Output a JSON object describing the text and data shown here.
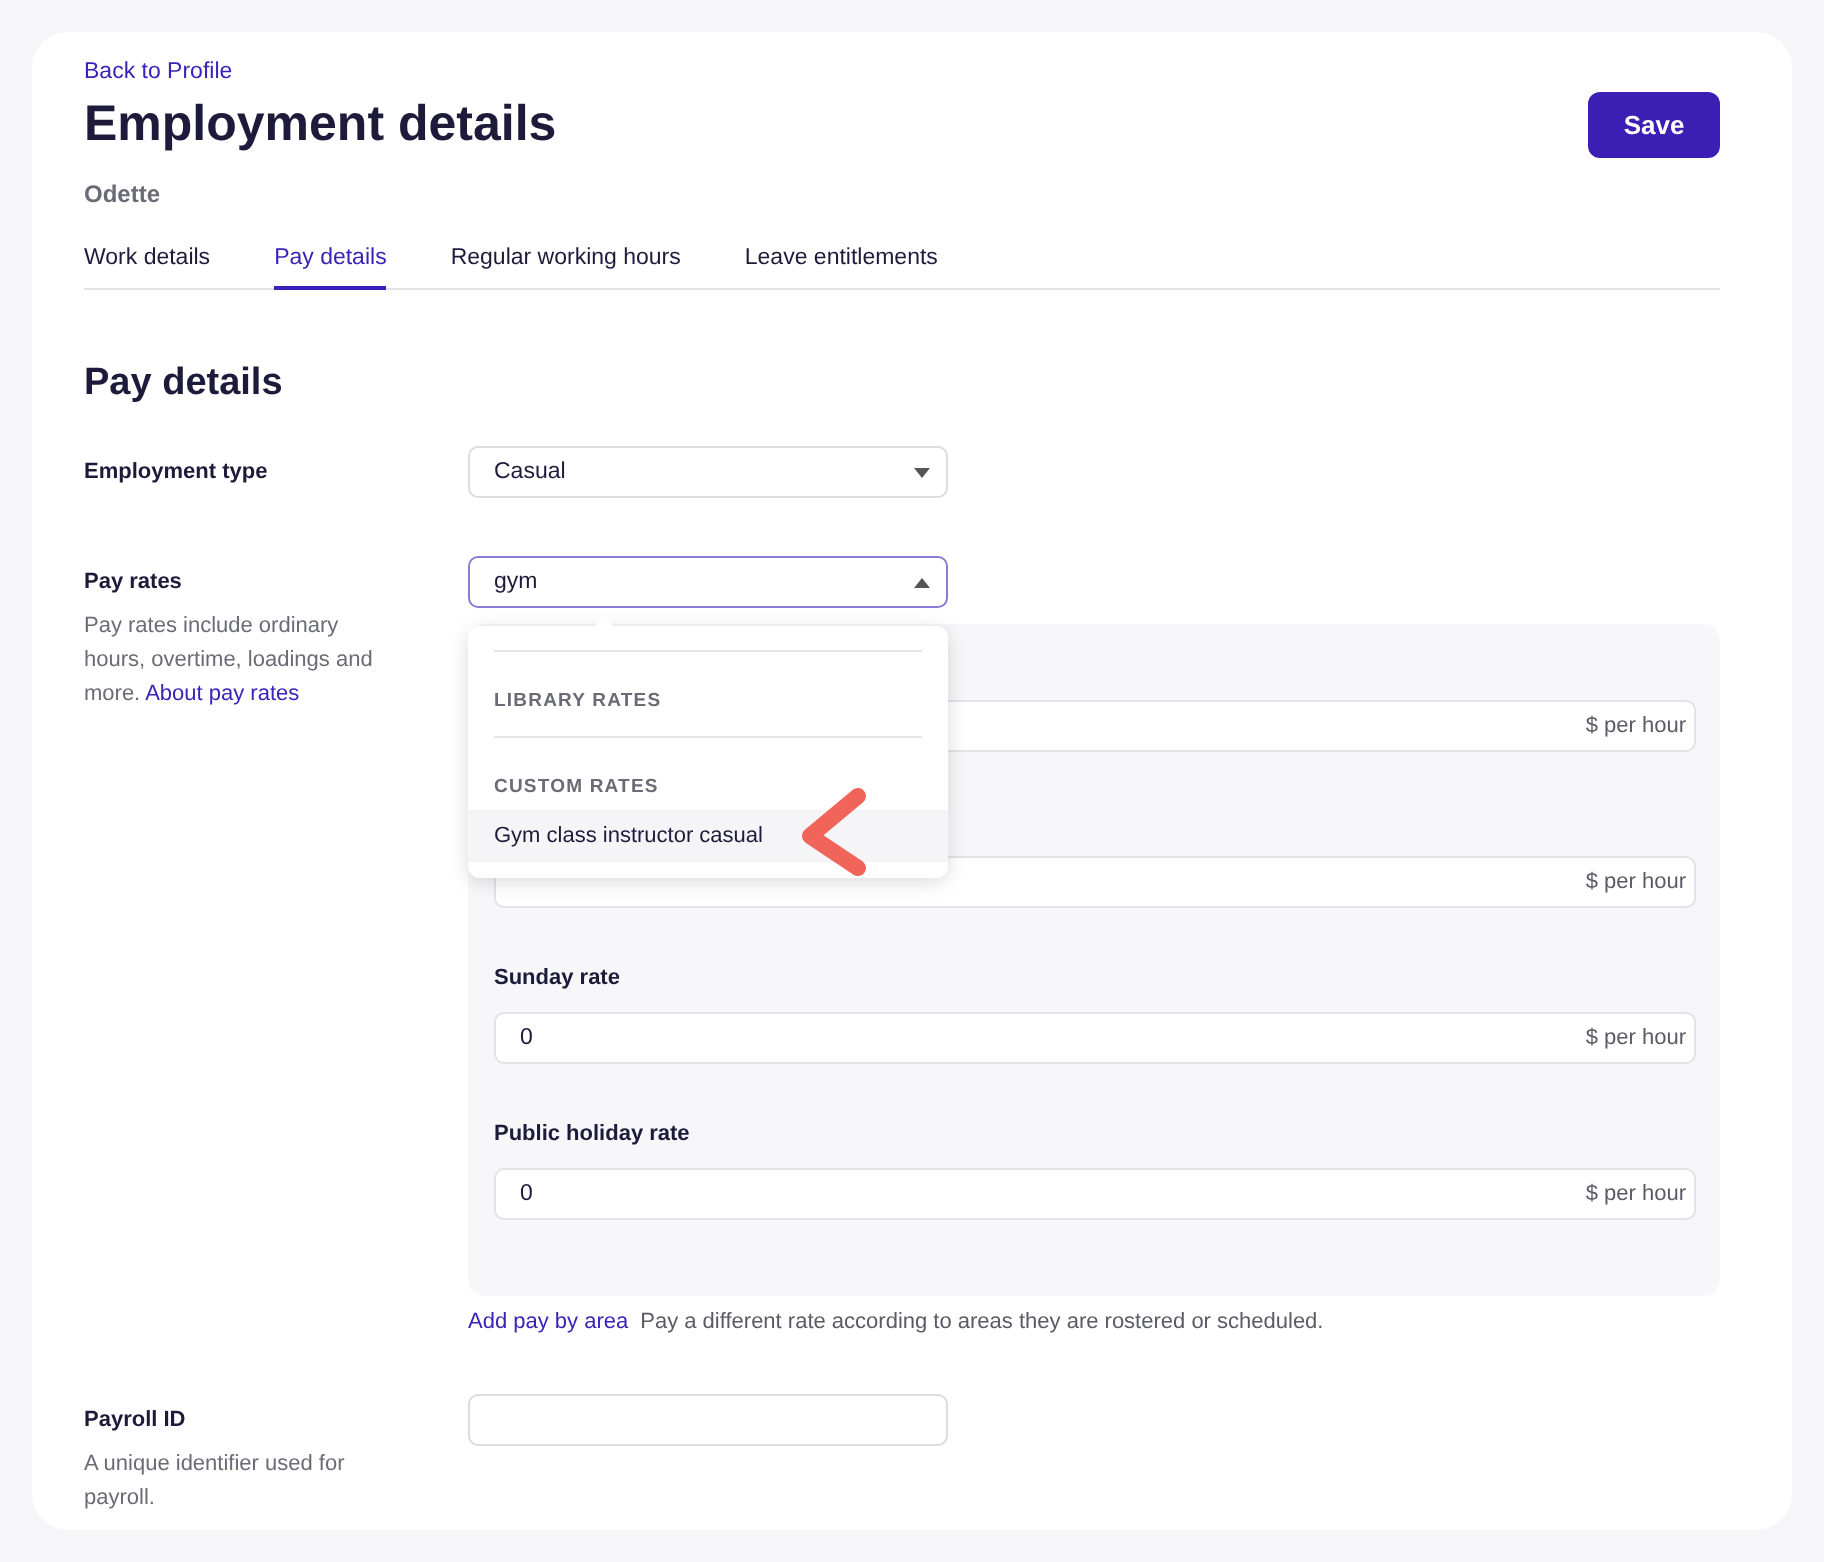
{
  "back_link": "Back to Profile",
  "title": "Employment details",
  "subtitle": "Odette",
  "save_button": "Save",
  "tabs": [
    {
      "label": "Work details",
      "selected": false
    },
    {
      "label": "Pay details",
      "selected": true
    },
    {
      "label": "Regular working hours",
      "selected": false
    },
    {
      "label": "Leave entitlements",
      "selected": false
    }
  ],
  "section_title": "Pay details",
  "employment_type": {
    "label": "Employment type",
    "value": "Casual"
  },
  "pay_rates": {
    "label": "Pay rates",
    "help": "Pay rates include ordinary hours, overtime, loadings and more.",
    "help_link": "About pay rates",
    "search": {
      "value": "gym",
      "expanded": true
    },
    "dropdown": {
      "groups": [
        {
          "heading": "LIBRARY RATES"
        },
        {
          "heading": "CUSTOM RATES",
          "items": [
            {
              "label": "Gym class instructor casual",
              "highlighted": true
            }
          ]
        }
      ]
    },
    "rates": [
      {
        "unit": "$ per hour"
      },
      {
        "unit": "$ per hour"
      },
      {
        "label": "Sunday rate",
        "value": "0",
        "unit": "$ per hour"
      },
      {
        "label": "Public holiday rate",
        "value": "0",
        "unit": "$ per hour"
      }
    ],
    "add_area": {
      "link": "Add pay by area",
      "text": "Pay a different rate according to areas they are rostered or scheduled."
    }
  },
  "payroll_id": {
    "label": "Payroll ID",
    "help": "A unique identifier used for payroll."
  }
}
